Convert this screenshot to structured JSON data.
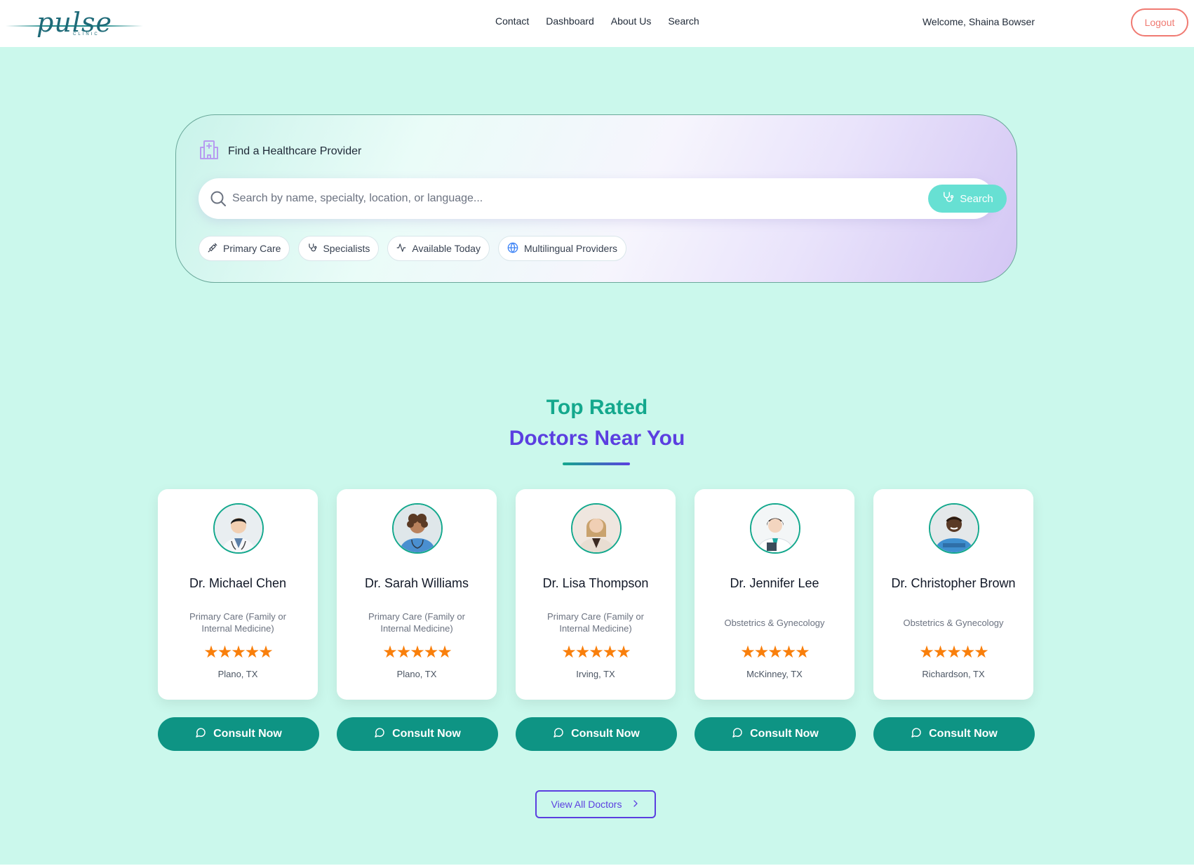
{
  "brand": {
    "name": "pulse",
    "sub": "CLINIC"
  },
  "nav": {
    "links": [
      "Contact",
      "Dashboard",
      "About Us",
      "Search"
    ],
    "welcome": "Welcome, Shaina Bowser",
    "logout": "Logout"
  },
  "search": {
    "title": "Find a Healthcare Provider",
    "placeholder": "Search by name, specialty, location, or language...",
    "button": "Search",
    "chips": [
      {
        "label": "Primary Care",
        "icon": "syringe-icon"
      },
      {
        "label": "Specialists",
        "icon": "stethoscope-icon"
      },
      {
        "label": "Available Today",
        "icon": "activity-icon"
      },
      {
        "label": "Multilingual Providers",
        "icon": "globe-icon"
      }
    ]
  },
  "section": {
    "title_line1": "Top Rated",
    "title_line2": "Doctors Near You"
  },
  "doctors": [
    {
      "name": "Dr. Michael Chen",
      "specialty": "Primary Care (Family or Internal Medicine)",
      "rating": 5,
      "location": "Plano, TX",
      "cta": "Consult Now"
    },
    {
      "name": "Dr. Sarah Williams",
      "specialty": "Primary Care (Family or Internal Medicine)",
      "rating": 5,
      "location": "Plano, TX",
      "cta": "Consult Now"
    },
    {
      "name": "Dr. Lisa Thompson",
      "specialty": "Primary Care (Family or Internal Medicine)",
      "rating": 5,
      "location": "Irving, TX",
      "cta": "Consult Now"
    },
    {
      "name": "Dr. Jennifer Lee",
      "specialty": "Obstetrics & Gynecology",
      "rating": 5,
      "location": "McKinney, TX",
      "cta": "Consult Now"
    },
    {
      "name": "Dr. Christopher Brown",
      "specialty": "Obstetrics & Gynecology",
      "rating": 5,
      "location": "Richardson, TX",
      "cta": "Consult Now"
    }
  ],
  "view_all": "View All Doctors",
  "colors": {
    "background": "#cbf8ec",
    "accent_teal": "#14a88d",
    "accent_purple": "#5b3fe0",
    "consult_button": "#0e9484",
    "search_button": "#67e0d3",
    "logout": "#f07a72",
    "stars": "#f97f0b"
  }
}
